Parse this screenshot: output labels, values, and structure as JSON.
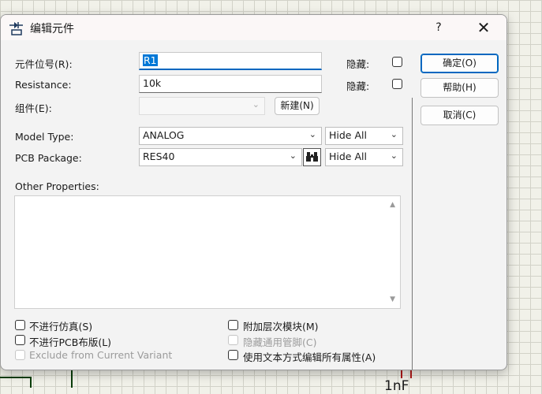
{
  "window": {
    "title": "编辑元件",
    "help_label": "?",
    "close_label": "✕"
  },
  "fields": {
    "ref_label": "元件位号(R):",
    "ref_value": "R1",
    "ref_hide_label": "隐藏:",
    "resistance_label": "Resistance:",
    "resistance_value": "10k",
    "resistance_hide_label": "隐藏:",
    "group_label": "组件(E):",
    "group_value": "",
    "new_button": "新建(N)",
    "model_type_label": "Model Type:",
    "model_type_value": "ANALOG",
    "model_type_visibility": "Hide All",
    "pcb_package_label": "PCB Package:",
    "pcb_package_value": "RES40",
    "pcb_package_visibility": "Hide All",
    "other_properties_label": "Other Properties:"
  },
  "buttons": {
    "ok": "确定(O)",
    "help": "帮助(H)",
    "cancel": "取消(C)"
  },
  "options": {
    "exclude_sim": "不进行仿真(S)",
    "exclude_pcb": "不进行PCB布版(L)",
    "exclude_variant": "Exclude from Current Variant",
    "attach_hierarchy": "附加层次模块(M)",
    "hide_common_pins": "隐藏通用管脚(C)",
    "edit_all_text": "使用文本方式编辑所有属性(A)"
  },
  "background": {
    "part_label": "1nF"
  }
}
